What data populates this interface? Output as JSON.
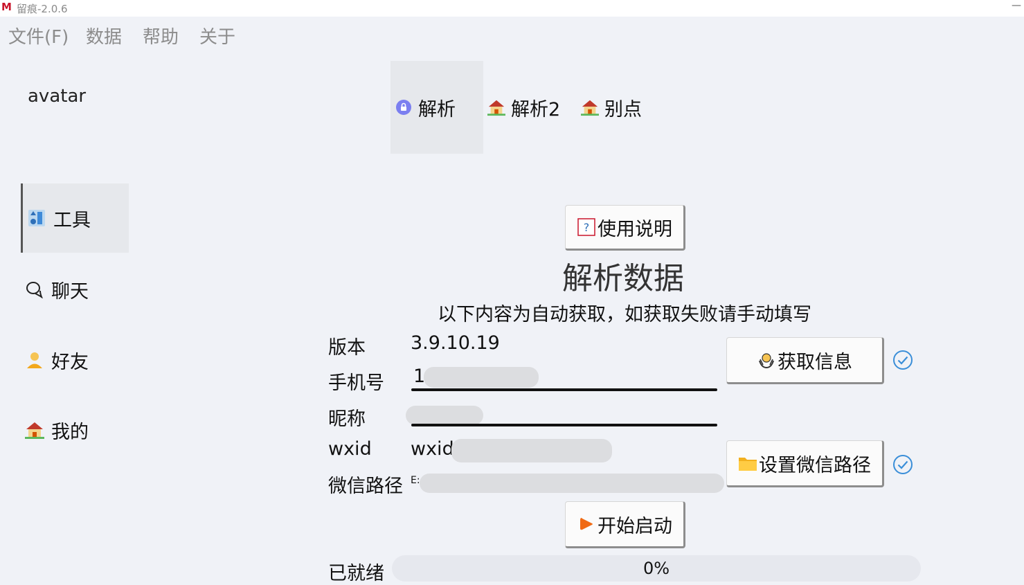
{
  "window": {
    "logo": "M",
    "title": "留痕-2.0.6",
    "minimize": "—"
  },
  "menu": [
    "文件(F)",
    "数据",
    "帮助",
    "关于"
  ],
  "avatar_label": "avatar",
  "nav": [
    {
      "label": "工具",
      "icon": "tools-icon",
      "active": true
    },
    {
      "label": "聊天",
      "icon": "chat-bubble-icon",
      "active": false
    },
    {
      "label": "好友",
      "icon": "person-icon",
      "active": false
    },
    {
      "label": "我的",
      "icon": "house-icon",
      "active": false
    }
  ],
  "tabs": [
    {
      "label": "解析",
      "icon": "purple-lock-icon",
      "active": true
    },
    {
      "label": "解析2",
      "icon": "house-icon",
      "active": false
    },
    {
      "label": "别点",
      "icon": "house-icon",
      "active": false
    }
  ],
  "help_button": {
    "label": "使用说明",
    "icon": "question-icon"
  },
  "heading": "解析数据",
  "subheading": "以下内容为自动获取，如获取失败请手动填写",
  "form": {
    "version_label": "版本",
    "version_value": "3.9.10.19",
    "phone_label": "手机号",
    "phone_value": "1",
    "nickname_label": "昵称",
    "nickname_value": "",
    "wxid_label": "wxid",
    "wxid_value": "wxid",
    "path_label": "微信路径",
    "path_value": "E:"
  },
  "get_info_button": {
    "label": "获取信息",
    "icon": "hands-icon"
  },
  "set_path_button": {
    "label": "设置微信路径",
    "icon": "folder-icon"
  },
  "start_button": {
    "label": "开始启动",
    "icon": "play-icon"
  },
  "status": "已就绪",
  "progress": {
    "value": 0,
    "text": "0%"
  },
  "colors": {
    "accent": "#3a8ed8",
    "background": "#f0f2f7",
    "logo": "#c9142a",
    "play": "#f06a14"
  }
}
